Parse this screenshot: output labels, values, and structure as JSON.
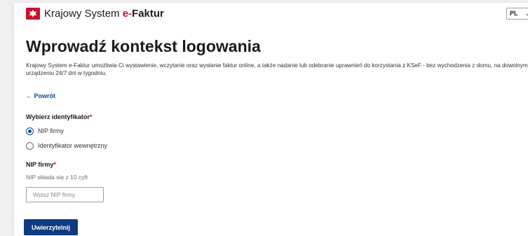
{
  "header": {
    "brand_text": "Krajowy System ",
    "brand_emphasis": "e-",
    "brand_emphasis2": "Faktur",
    "language": "PL"
  },
  "main": {
    "title": "Wprowadź kontekst logowania",
    "description": "Krajowy System e-Faktur umożliwia Ci wystawienie, wczytanie oraz wysłanie faktur online, a także nadanie lub odebranie uprawnień do korzystania z KSeF - bez wychodzenia z domu, na dowolnym urządzeniu 24/7 dni w tygodniu.",
    "back_link": "Powrót",
    "identifier_label": "Wybierz identyfikator",
    "required_mark": "*",
    "identifier_options": [
      {
        "label": "NIP firmy",
        "checked": true
      },
      {
        "label": "Identyfikator wewnętrzny",
        "checked": false
      }
    ],
    "nip_label": "NIP firmy",
    "nip_hint": "NIP składa się z 10 cyfr",
    "nip_placeholder": "Wpisz NIP firmy",
    "nip_value": "",
    "submit_label": "Uwierzytelnij"
  },
  "colors": {
    "accent": "#0f3b83",
    "link": "#0f4ca0",
    "required": "#d0021b",
    "brand_red": "#c8102e"
  }
}
